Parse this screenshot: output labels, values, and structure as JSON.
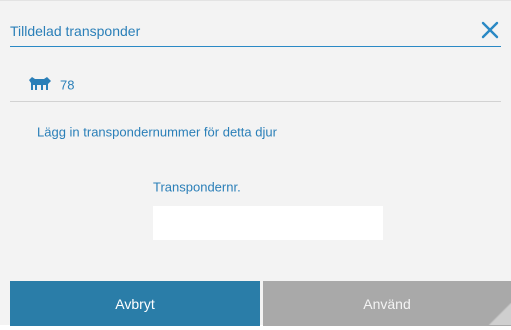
{
  "dialog": {
    "title": "Tilldelad transponder",
    "close_icon": "close-icon"
  },
  "animal": {
    "icon": "cow-icon",
    "id": "78"
  },
  "instruction": "Lägg in transpondernummer för detta djur",
  "transponder": {
    "label": "Transpondernr.",
    "value": ""
  },
  "buttons": {
    "cancel_label": "Avbryt",
    "apply_label": "Använd"
  },
  "colors": {
    "accent": "#2a7fb8",
    "cancel_button": "#2a7da8",
    "apply_button_disabled": "#a9a9a9",
    "background": "#f3f3f3"
  }
}
